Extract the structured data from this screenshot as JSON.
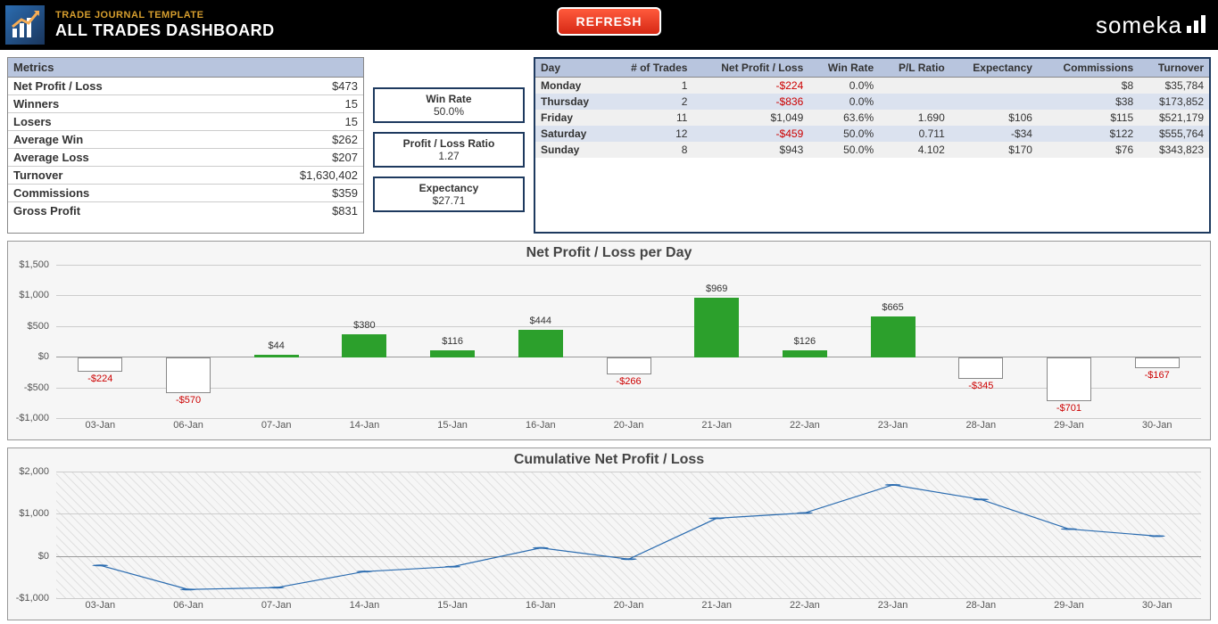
{
  "header": {
    "subtitle": "TRADE JOURNAL TEMPLATE",
    "title": "ALL TRADES DASHBOARD",
    "refresh": "REFRESH",
    "brand": "someka"
  },
  "metrics": {
    "heading": "Metrics",
    "rows": [
      {
        "label": "Net Profit / Loss",
        "value": "$473"
      },
      {
        "label": "Winners",
        "value": "15"
      },
      {
        "label": "Losers",
        "value": "15"
      },
      {
        "label": "Average Win",
        "value": "$262"
      },
      {
        "label": "Average Loss",
        "value": "$207"
      },
      {
        "label": "Turnover",
        "value": "$1,630,402"
      },
      {
        "label": "Commissions",
        "value": "$359"
      },
      {
        "label": "Gross Profit",
        "value": "$831"
      }
    ]
  },
  "kpis": [
    {
      "label": "Win Rate",
      "value": "50.0%"
    },
    {
      "label": "Profit / Loss Ratio",
      "value": "1.27"
    },
    {
      "label": "Expectancy",
      "value": "$27.71"
    }
  ],
  "day_table": {
    "headers": [
      "Day",
      "# of Trades",
      "Net Profit / Loss",
      "Win Rate",
      "P/L Ratio",
      "Expectancy",
      "Commissions",
      "Turnover"
    ],
    "rows": [
      {
        "day": "Monday",
        "trades": "1",
        "npl": "-$224",
        "npl_neg": true,
        "wr": "0.0%",
        "plr": "",
        "exp": "",
        "com": "$8",
        "to": "$35,784"
      },
      {
        "day": "Thursday",
        "trades": "2",
        "npl": "-$836",
        "npl_neg": true,
        "wr": "0.0%",
        "plr": "",
        "exp": "",
        "com": "$38",
        "to": "$173,852"
      },
      {
        "day": "Friday",
        "trades": "11",
        "npl": "$1,049",
        "npl_neg": false,
        "wr": "63.6%",
        "plr": "1.690",
        "exp": "$106",
        "com": "$115",
        "to": "$521,179"
      },
      {
        "day": "Saturday",
        "trades": "12",
        "npl": "-$459",
        "npl_neg": true,
        "wr": "50.0%",
        "plr": "0.711",
        "exp": "-$34",
        "com": "$122",
        "to": "$555,764"
      },
      {
        "day": "Sunday",
        "trades": "8",
        "npl": "$943",
        "npl_neg": false,
        "wr": "50.0%",
        "plr": "4.102",
        "exp": "$170",
        "com": "$76",
        "to": "$343,823"
      }
    ]
  },
  "chart_data": [
    {
      "type": "bar",
      "title": "Net Profit / Loss per Day",
      "categories": [
        "03-Jan",
        "06-Jan",
        "07-Jan",
        "14-Jan",
        "15-Jan",
        "16-Jan",
        "20-Jan",
        "21-Jan",
        "22-Jan",
        "23-Jan",
        "28-Jan",
        "29-Jan",
        "30-Jan"
      ],
      "values": [
        -224,
        -570,
        44,
        380,
        116,
        444,
        -266,
        969,
        126,
        665,
        -345,
        -701,
        -167
      ],
      "ylim": [
        -1000,
        1500
      ],
      "yticks": [
        -1000,
        -500,
        0,
        500,
        1000,
        1500
      ]
    },
    {
      "type": "line",
      "title": "Cumulative Net Profit / Loss",
      "categories": [
        "03-Jan",
        "06-Jan",
        "07-Jan",
        "14-Jan",
        "15-Jan",
        "16-Jan",
        "20-Jan",
        "21-Jan",
        "22-Jan",
        "23-Jan",
        "28-Jan",
        "29-Jan",
        "30-Jan"
      ],
      "values": [
        -224,
        -794,
        -750,
        -370,
        -254,
        190,
        -76,
        893,
        1019,
        1684,
        1339,
        638,
        471
      ],
      "ylim": [
        -1000,
        2000
      ],
      "yticks": [
        -1000,
        0,
        1000,
        2000
      ]
    }
  ]
}
